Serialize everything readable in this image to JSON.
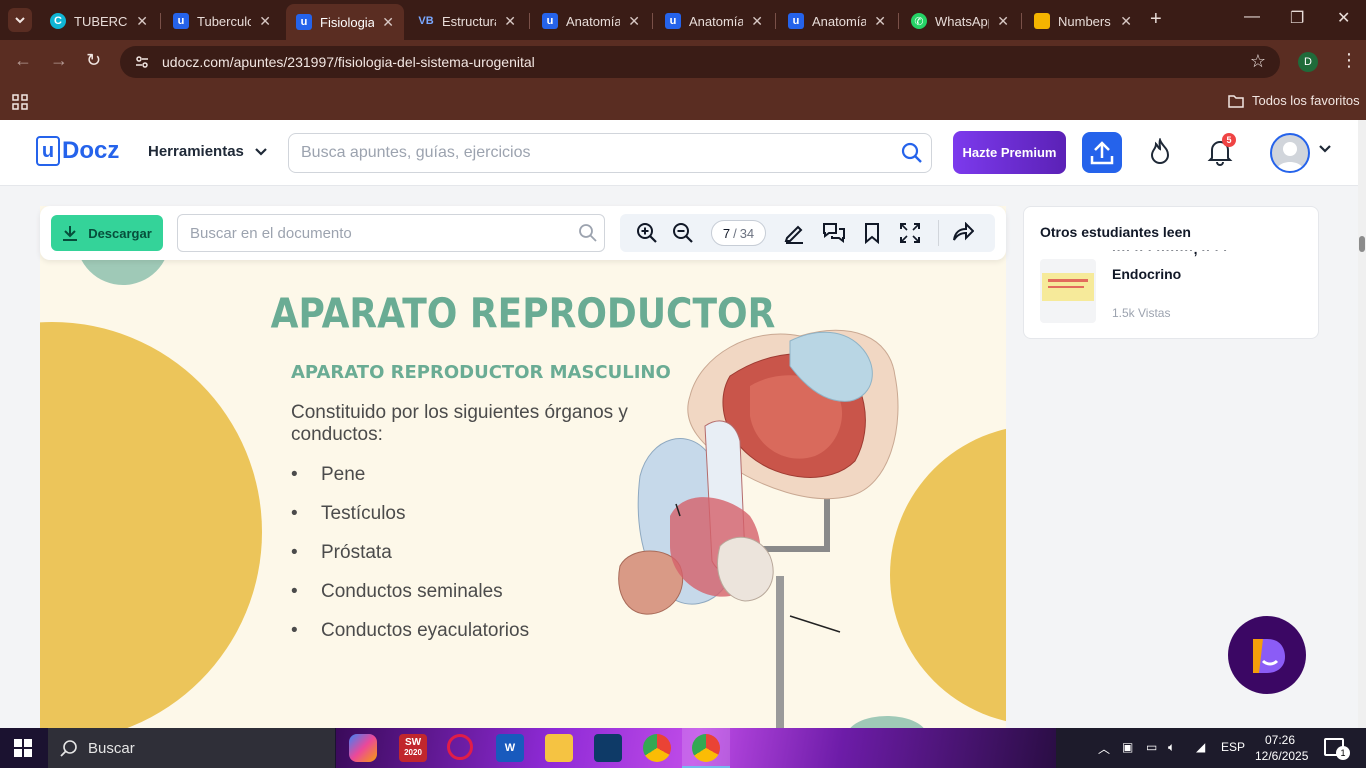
{
  "browser": {
    "tabs": [
      {
        "title": "TUBERCU",
        "favicon": "canva-icon",
        "color": "#0fb5d4",
        "active": false
      },
      {
        "title": "Tuberculo",
        "favicon": "udocz-icon",
        "color": "#2563eb",
        "active": false
      },
      {
        "title": "Fisiologia",
        "favicon": "udocz-icon",
        "color": "#2563eb",
        "active": true
      },
      {
        "title": "Estructura",
        "favicon": "vb-icon",
        "color": "#3a1c16",
        "active": false
      },
      {
        "title": "Anatomía",
        "favicon": "udocz-icon",
        "color": "#2563eb",
        "active": false
      },
      {
        "title": "Anatomía",
        "favicon": "udocz-icon",
        "color": "#2563eb",
        "active": false
      },
      {
        "title": "Anatomía",
        "favicon": "udocz-icon",
        "color": "#2563eb",
        "active": false
      },
      {
        "title": "WhatsApp",
        "favicon": "whatsapp-icon",
        "color": "#25d366",
        "active": false
      },
      {
        "title": "Numbers",
        "favicon": "slides-icon",
        "color": "#f4b400",
        "active": false
      }
    ],
    "vb_label": "VB",
    "url": "udocz.com/apuntes/231997/fisiologia-del-sistema-urogenital",
    "profile_initial": "D",
    "bookmarks_label": "Todos los favoritos"
  },
  "header": {
    "logo_u": "u",
    "logo_text": "Docz",
    "tools_label": "Herramientas",
    "search_placeholder": "Busca apuntes, guías, ejercicios",
    "premium_label": "Hazte Premium",
    "notification_count": "5"
  },
  "viewer": {
    "download_label": "Descargar",
    "search_placeholder": "Buscar en el documento",
    "current_page": "7",
    "page_separator": "/",
    "total_pages": "34"
  },
  "slide": {
    "title": "APARATO REPRODUCTOR",
    "subtitle": "APARATO REPRODUCTOR MASCULINO",
    "intro": "Constituido por los siguientes órganos y conductos:",
    "bullet": "•",
    "items": [
      "Pene",
      "Testículos",
      "Próstata",
      "Conductos seminales",
      "Conductos eyaculatorios"
    ]
  },
  "sidebar": {
    "title": "Otros estudiantes leen",
    "doc_title": "Endocrino",
    "doc_views": "1.5k Vistas"
  },
  "taskbar": {
    "search_label": "Buscar",
    "sw_label": "SW",
    "sw_year": "2020",
    "language": "ESP",
    "time": "07:26",
    "date": "12/6/2025",
    "notification_count": "1"
  },
  "colors": {
    "slide_green": "#6aac94",
    "slide_yellow": "#ecc55a",
    "slide_bg": "#fdf8e9",
    "accent_blue": "#2563eb",
    "premium_purple": "#7c3aed",
    "download_green": "#34d399"
  }
}
